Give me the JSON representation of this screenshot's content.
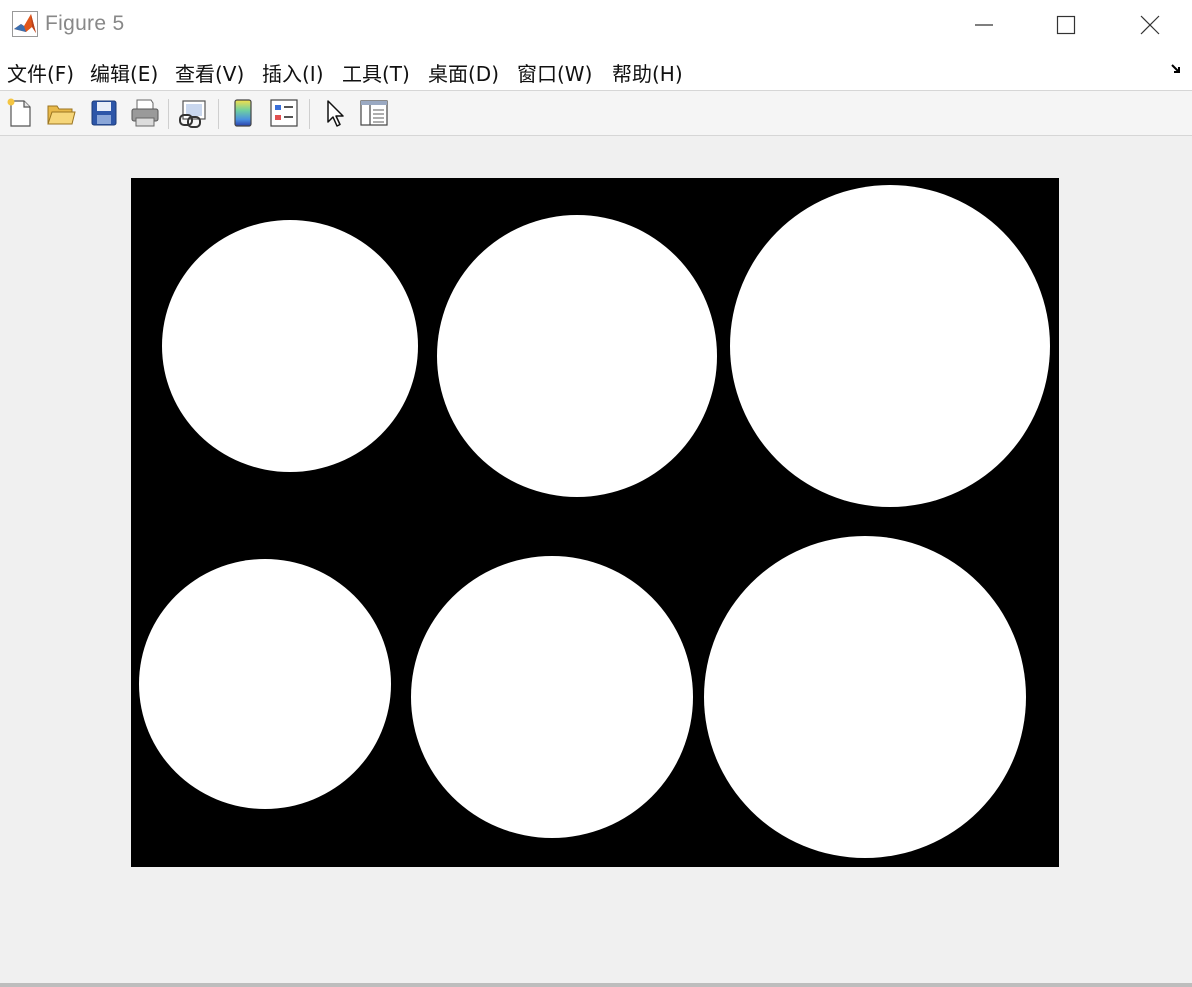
{
  "window": {
    "title": "Figure 5",
    "controls": {
      "minimize": "minimize",
      "maximize": "maximize",
      "close": "close"
    }
  },
  "menu": [
    {
      "label": "文件(F)"
    },
    {
      "label": "编辑(E)"
    },
    {
      "label": "查看(V)"
    },
    {
      "label": "插入(I)"
    },
    {
      "label": "工具(T)"
    },
    {
      "label": "桌面(D)"
    },
    {
      "label": "窗口(W)"
    },
    {
      "label": "帮助(H)"
    }
  ],
  "toolbar": [
    {
      "icon": "new-figure-icon"
    },
    {
      "icon": "open-file-icon"
    },
    {
      "icon": "save-icon"
    },
    {
      "icon": "print-icon"
    },
    {
      "icon": "link-plot-icon"
    },
    {
      "icon": "insert-colorbar-icon"
    },
    {
      "icon": "insert-legend-icon"
    },
    {
      "icon": "edit-plot-pointer-icon"
    },
    {
      "icon": "property-inspector-icon"
    }
  ],
  "image": {
    "description_colors": {
      "background": "#000000",
      "foreground": "#ffffff"
    },
    "blob_count": 6
  },
  "colors": {
    "matlab_orange": "#e0561b",
    "title_gray": "#888888"
  }
}
